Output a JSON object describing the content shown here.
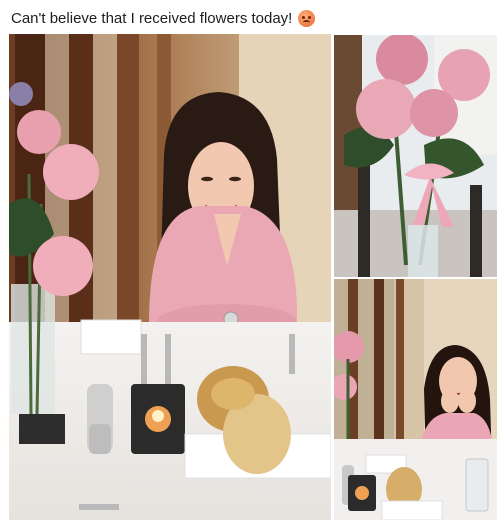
{
  "post": {
    "text": "Can't believe that I received flowers today!",
    "emoji": "angry-face-emoji"
  },
  "photos": [
    {
      "subject": "woman-at-restaurant-table-with-bread-and-flowers"
    },
    {
      "subject": "pink-roses-in-vase"
    },
    {
      "subject": "woman-resting-chin-on-hands-at-table"
    }
  ]
}
